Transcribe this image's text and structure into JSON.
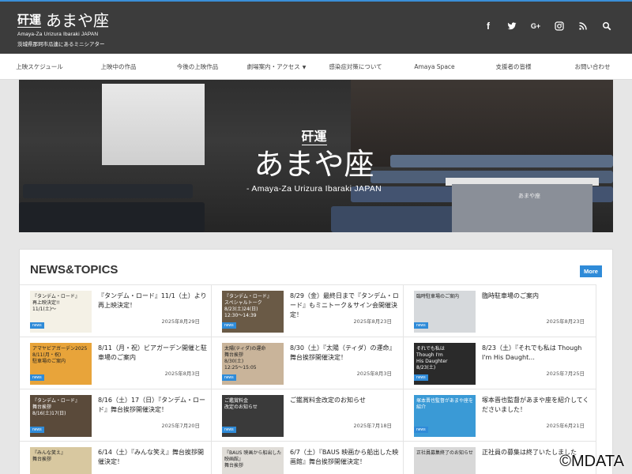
{
  "header": {
    "logo_mark": "矸運",
    "title": "あまや座",
    "subtitle_en": "Amaya-Za Urizura Ibaraki JAPAN",
    "tagline": "茨城県那珂市瓜連にあるミニシアター",
    "social": [
      {
        "name": "facebook-icon",
        "glyph": "f"
      },
      {
        "name": "twitter-icon",
        "glyph": "t"
      },
      {
        "name": "google-plus-icon",
        "glyph": "G+"
      },
      {
        "name": "instagram-icon",
        "glyph": "ig"
      },
      {
        "name": "rss-icon",
        "glyph": "rss"
      },
      {
        "name": "search-icon",
        "glyph": "search"
      }
    ]
  },
  "nav": {
    "items": [
      "上映スケジュール",
      "上映中の作品",
      "今後の上映作品",
      "劇場案内・アクセス",
      "感染症対策について",
      "Amaya Space",
      "支援者の皆様",
      "お問い合わせ"
    ],
    "dropdown_index": 3
  },
  "hero": {
    "logo_mark": "矸運",
    "title": "あまや座",
    "subtitle_en": "- Amaya-Za Urizura Ibaraki JAPAN",
    "building_sign": "あまや座"
  },
  "news": {
    "heading": "NEWS&TOPICS",
    "more_label": "More",
    "badge_label": "news",
    "cards": [
      {
        "title": "『タンデム・ロード』11/1（土）より再上映決定！",
        "date": "2025年8月29日",
        "thumb": "『タンデム・ロード』\n再上映決定!!\n11/1(土)〜",
        "bg": "#f4f1e6"
      },
      {
        "title": "8/29（金）最終日まで『タンデム・ロード』もミニトーク＆サイン会開催決定！",
        "date": "2025年8月23日",
        "thumb": "『タンデム・ロード』\nスペシャルトーク\n8/23(土)24(日)\n12:30〜14:39",
        "bg": "#6a5a46"
      },
      {
        "title": "臨時駐車場のご案内",
        "date": "2025年8月23日",
        "thumb": "臨時駐車場のご案内",
        "bg": "#d6d9dc"
      },
      {
        "title": "8/11（月・祝）ビアガーデン開催と駐車場のご案内",
        "date": "2025年8月3日",
        "thumb": "アマヤビアガーデン2025\n8/11(月・祝)\n駐車場のご案内",
        "bg": "#e8a43a"
      },
      {
        "title": "8/30（土）『太陽（ティダ）の運命』舞台挨拶開催決定！",
        "date": "2025年8月3日",
        "thumb": "太陽(ティダ)の運命\n舞台挨拶\n8/30(土)\n12:25〜15:05",
        "bg": "#c9b49a"
      },
      {
        "title": "8/23（土）『それでも私は Though I'm His Daught...",
        "date": "2025年7月25日",
        "thumb": "それでも私は\nThough I'm\nHis Daughter\n8/23(土)",
        "bg": "#2a2a2a"
      },
      {
        "title": "8/16（土）17（日）『タンデム・ロード』舞台挨拶開催決定！",
        "date": "2025年7月20日",
        "thumb": "『タンデム・ロード』\n舞台挨拶\n8/16(土)17(日)",
        "bg": "#5a4a3a"
      },
      {
        "title": "ご鑑賞料金改定のお知らせ",
        "date": "2025年7月18日",
        "thumb": "ご鑑賞料金\n改定のお知らせ",
        "bg": "#3a3a3a"
      },
      {
        "title": "塚本晋也監督があまや座を紹介してくださいました！",
        "date": "2025年6月21日",
        "thumb": "塚本晋也監督があまや座を紹介",
        "bg": "#3a9ad6"
      },
      {
        "title": "6/14（土）『みんな笑え』舞台挨拶開催決定！",
        "date": "",
        "thumb": "『みんな笑え』\n舞台挨拶",
        "bg": "#d8c8a0"
      },
      {
        "title": "6/7（土）『BAUS 映画から船出した映画館』舞台挨拶開催決定！",
        "date": "",
        "thumb": "『BAUS 映画から船出した映画館』\n舞台挨拶",
        "bg": "#e0ddd8"
      },
      {
        "title": "正社員の募集は終了いたしました",
        "date": "",
        "thumb": "正社員募集終了のお知らせ",
        "bg": "#d8d8d8"
      }
    ]
  },
  "watermark": "©MDATA"
}
